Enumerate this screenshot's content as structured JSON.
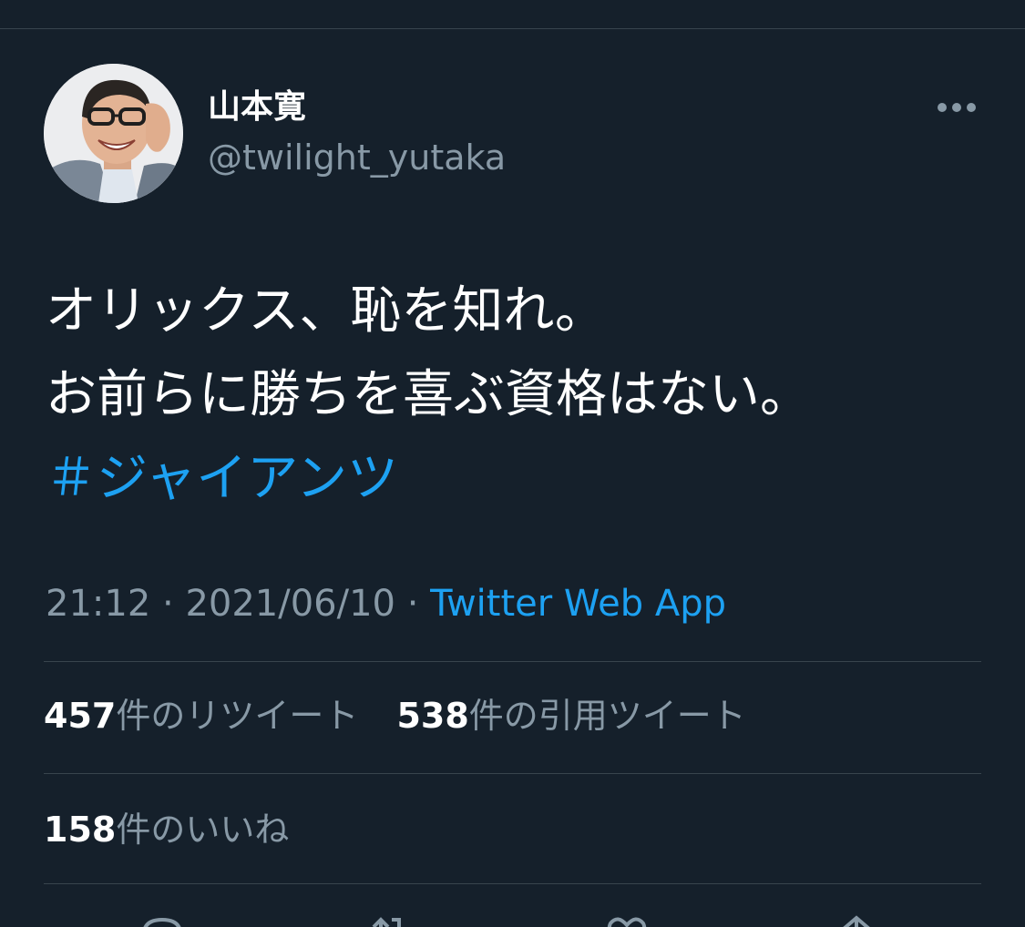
{
  "tweet": {
    "author": {
      "display_name": "山本寛",
      "handle": "@twilight_yutaka"
    },
    "text_lines": [
      "オリックス、恥を知れ。",
      "お前らに勝ちを喜ぶ資格はない。"
    ],
    "hashtag": "＃ジャイアンツ",
    "time": "21:12",
    "separator": " · ",
    "date": "2021/06/10",
    "source": "Twitter Web App",
    "stats": {
      "retweets": {
        "count": "457",
        "label": "件のリツイート"
      },
      "quotes": {
        "count": "538",
        "label": "件の引用ツイート"
      },
      "likes": {
        "count": "158",
        "label": "件のいいね"
      }
    }
  },
  "icons": {
    "more": "more-horizontal-icon",
    "reply": "reply-icon",
    "retweet": "retweet-icon",
    "like": "heart-icon",
    "share": "share-icon"
  },
  "colors": {
    "background": "#15202b",
    "accent": "#1da1f2",
    "secondary_text": "#8899a6",
    "divider": "#38444d"
  }
}
